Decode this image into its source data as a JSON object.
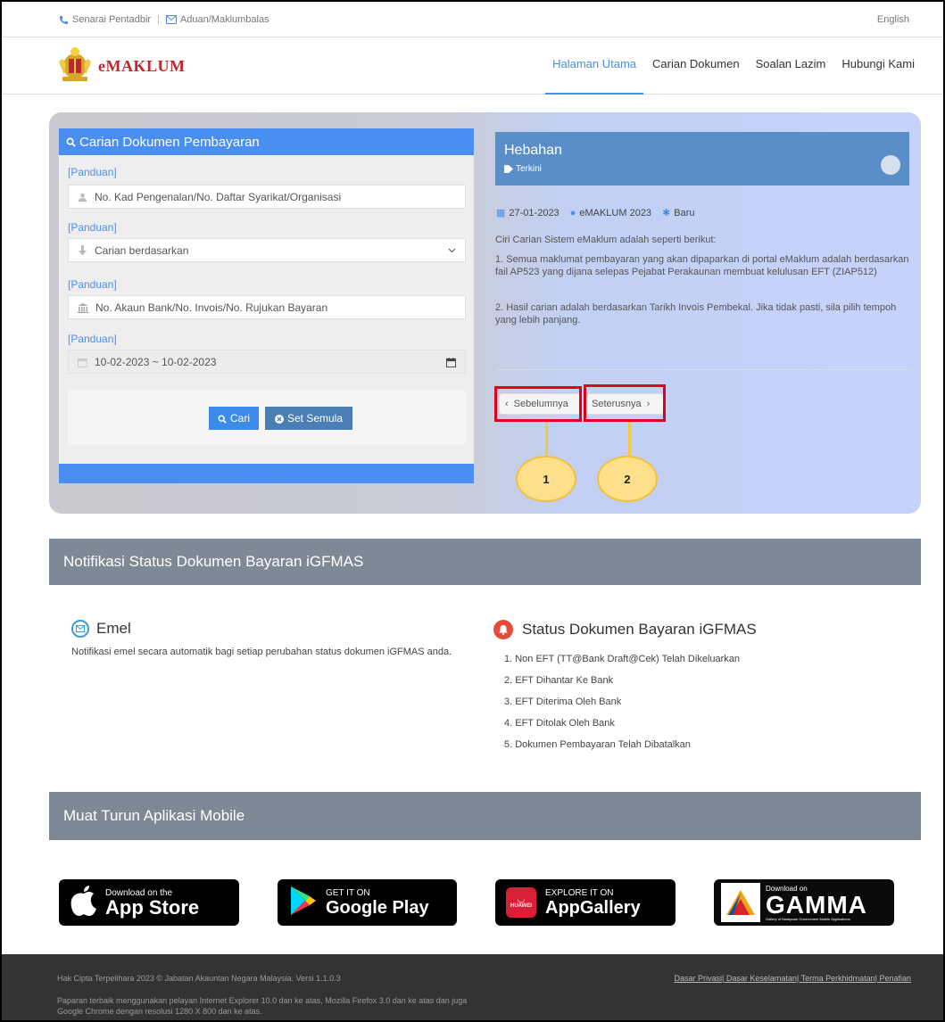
{
  "topbar": {
    "senarai": "Senarai Pentadbir",
    "aduan": "Aduan/Maklumbalas",
    "lang": "English"
  },
  "header": {
    "logo_text": "eMAKLUM",
    "nav": [
      "Halaman Utama",
      "Carian Dokumen",
      "Soalan Lazim",
      "Hubungi Kami"
    ],
    "active_nav": "Halaman Utama"
  },
  "search": {
    "title": "Carian Dokumen Pembayaran",
    "panduan": "[Panduan]",
    "id_placeholder": "No. Kad Pengenalan/No. Daftar Syarikat/Organisasi",
    "search_by": "Carian berdasarkan",
    "account_placeholder": "No. Akaun Bank/No. Invois/No. Rujukan Bayaran",
    "date_range": "10-02-2023 ~ 10-02-2023",
    "btn_search": "Cari",
    "btn_reset": "Set Semula"
  },
  "hebahan": {
    "title": "Hebahan",
    "subtitle": "Terkini",
    "date": "27-01-2023",
    "author": "eMAKLUM 2023",
    "tag": "Baru",
    "intro": "Ciri Carian Sistem eMaklum adalah seperti berikut:",
    "point1": "1. Semua maklumat pembayaran yang akan dipaparkan di portal eMaklum adalah berdasarkan fail AP523 yang dijana selepas Pejabat Perakaunan membuat kelulusan EFT (ZIAP512)",
    "point2": "2. Hasil carian adalah berdasarkan Tarikh Invois Pembekal. Jika tidak pasti, sila pilih tempoh yang lebih panjang.",
    "prev": "Sebelumnya",
    "next": "Seterusnya"
  },
  "callouts": [
    "1",
    "2"
  ],
  "notifikasi": {
    "title": "Notifikasi Status Dokumen Bayaran iGFMAS",
    "emel_title": "Emel",
    "emel_desc": "Notifikasi emel secara automatik bagi setiap perubahan status dokumen iGFMAS anda.",
    "status_title": "Status Dokumen Bayaran iGFMAS",
    "status_items": [
      "1. Non EFT (TT@Bank Draft@Cek) Telah Dikeluarkan",
      "2. EFT Dihantar Ke Bank",
      "3. EFT Diterima Oleh Bank",
      "4. EFT Ditolak Oleh Bank",
      "5. Dokumen Pembayaran Telah Dibatalkan"
    ]
  },
  "mobile": {
    "title": "Muat Turun Aplikasi Mobile",
    "appstore_small": "Download on the",
    "appstore_big": "App Store",
    "gplay_small": "GET IT ON",
    "gplay_big": "Google Play",
    "huawei_small": "EXPLORE IT ON",
    "huawei_big": "AppGallery",
    "huawei_logo": "HUAWEI",
    "gamma_small": "Download on",
    "gamma_big": "GAMMA",
    "gamma_tag": "Gallery of Malaysian Government Mobile Applications"
  },
  "footer": {
    "copyright": "Hak Cipta Terpelihara 2023 © Jabatan Akauntan Negara Malaysia. Versi 1.1.0.3",
    "note": "Paparan terbaik menggunakan pelayan Internet Explorer 10.0 dan ke atas, Mozilla Firefox 3.0 dan ke atas dan juga Google Chrome dengan resolusi 1280 X 800 dan ke atas.",
    "links": "Dasar Privasi| Dasar Keselamatan| Terma Perkhidmatan| Penafian"
  },
  "colors": {
    "accent": "#4a8ff0",
    "band": "#7d8a96",
    "highlight": "#e1001a",
    "callout": "#ffe08a"
  }
}
